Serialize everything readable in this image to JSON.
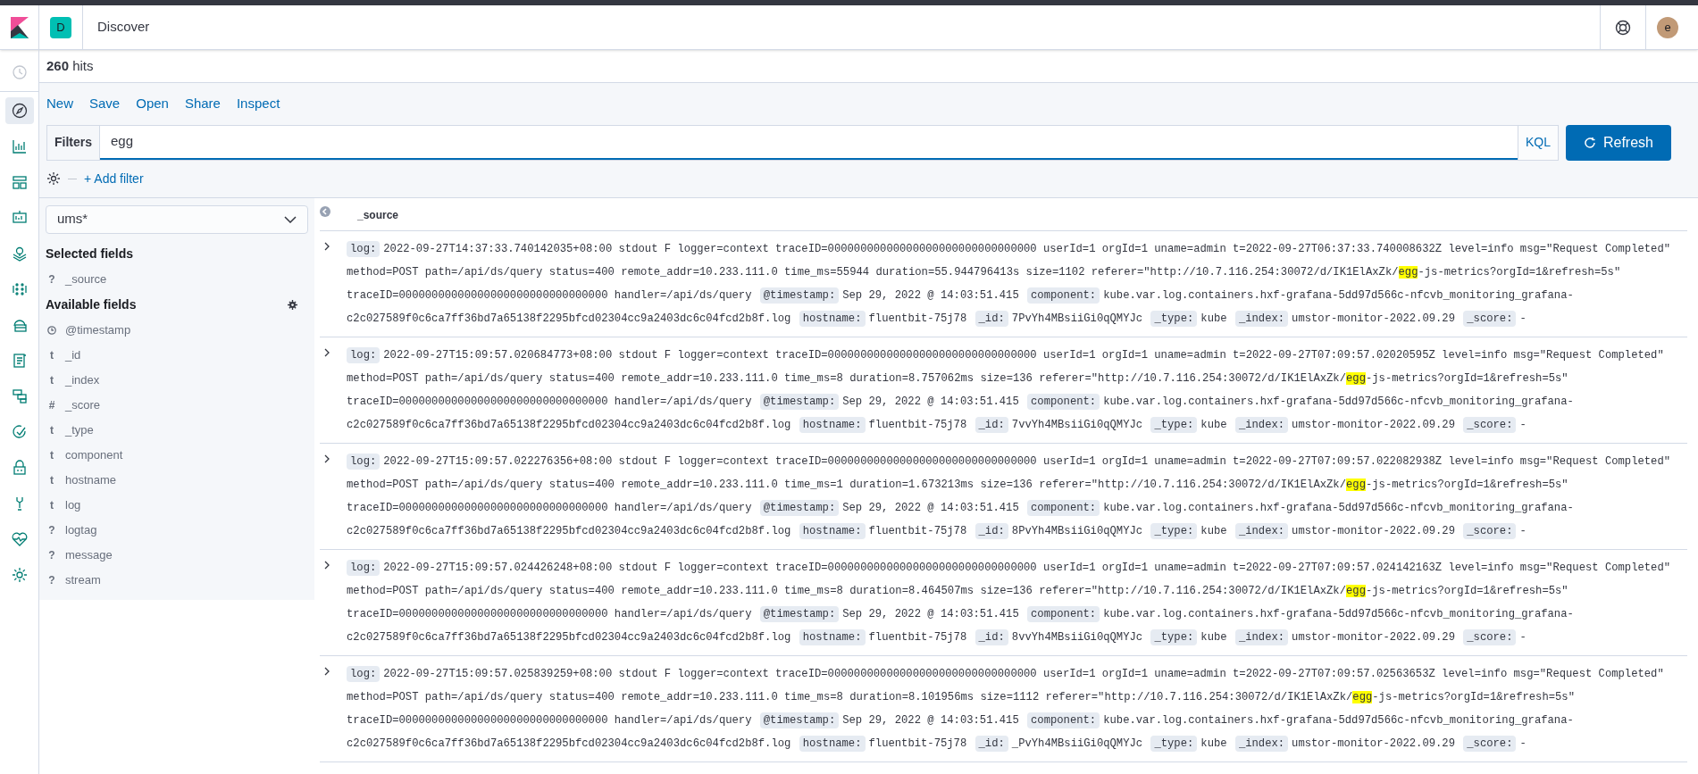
{
  "header": {
    "space_badge": "D",
    "title": "Discover",
    "avatar": "e"
  },
  "hits": {
    "count": "260",
    "label": "hits"
  },
  "top_menu": [
    "New",
    "Save",
    "Open",
    "Share",
    "Inspect"
  ],
  "query": {
    "filters_label": "Filters",
    "value": "egg",
    "language": "KQL",
    "refresh": "Refresh"
  },
  "add_filter": "+ Add filter",
  "nav_items": [
    {
      "selected": false,
      "disabled": true
    },
    {
      "selected": true,
      "disabled": false
    },
    {
      "selected": false,
      "disabled": false
    },
    {
      "selected": false,
      "disabled": false
    },
    {
      "selected": false,
      "disabled": false
    },
    {
      "selected": false,
      "disabled": false
    },
    {
      "selected": false,
      "disabled": false
    },
    {
      "selected": false,
      "disabled": false
    },
    {
      "selected": false,
      "disabled": false
    },
    {
      "selected": false,
      "disabled": false
    },
    {
      "selected": false,
      "disabled": false
    },
    {
      "selected": false,
      "disabled": false
    },
    {
      "selected": false,
      "disabled": false
    },
    {
      "selected": false,
      "disabled": false
    },
    {
      "selected": false,
      "disabled": false
    }
  ],
  "sidebar": {
    "index_pattern": "ums*",
    "selected_title": "Selected fields",
    "selected_fields": [
      {
        "kind": "glyph",
        "type": "?",
        "name": "_source"
      }
    ],
    "available_title": "Available fields",
    "available_fields": [
      {
        "kind": "clock",
        "name": "@timestamp"
      },
      {
        "kind": "glyph",
        "type": "t",
        "name": "_id"
      },
      {
        "kind": "glyph",
        "type": "t",
        "name": "_index"
      },
      {
        "kind": "glyph",
        "type": "#",
        "name": "_score"
      },
      {
        "kind": "glyph",
        "type": "t",
        "name": "_type"
      },
      {
        "kind": "glyph",
        "type": "t",
        "name": "component"
      },
      {
        "kind": "glyph",
        "type": "t",
        "name": "hostname"
      },
      {
        "kind": "glyph",
        "type": "t",
        "name": "log"
      },
      {
        "kind": "glyph",
        "type": "?",
        "name": "logtag"
      },
      {
        "kind": "glyph",
        "type": "?",
        "name": "message"
      },
      {
        "kind": "glyph",
        "type": "?",
        "name": "stream"
      }
    ]
  },
  "table": {
    "column": "_source",
    "rows": [
      {
        "fields": [
          {
            "key": "log:",
            "parts": [
              {
                "text": "2022-09-27T14:37:33.740142035+08:00 stdout F logger=context traceID=00000000000000000000000000000000 userId=1 orgId=1 uname=admin t=2022-09-27T06:37:33.740008632Z level=info msg=\"Request Completed\" method=POST path=/api/ds/query status=400 remote_addr=10.233.111.0 time_ms=55944 duration=55.944796413s size=1102 referer=\"http://10.7.116.254:30072/d/IK1ElAxZk/",
                "highlight": false
              },
              {
                "text": "egg",
                "highlight": true
              },
              {
                "text": "-js-metrics?orgId=1&refresh=5s\" traceID=00000000000000000000000000000000 handler=/api/ds/query",
                "highlight": false
              }
            ]
          },
          {
            "key": "@timestamp:",
            "parts": [
              {
                "text": "Sep 29, 2022 @ 14:03:51.415",
                "highlight": false
              }
            ]
          },
          {
            "key": "component:",
            "parts": [
              {
                "text": "kube.var.log.containers.hxf-grafana-5dd97d566c-nfcvb_monitoring_grafana-c2c027589f0c6ca7ff36bd7a65138f2295bfcd02304cc9a2403dc6c04fcd2b8f.log",
                "highlight": false
              }
            ]
          },
          {
            "key": "hostname:",
            "parts": [
              {
                "text": "fluentbit-75j78",
                "highlight": false
              }
            ]
          },
          {
            "key": "_id:",
            "parts": [
              {
                "text": "7PvYh4MBsiiGi0qQMYJc",
                "highlight": false
              }
            ]
          },
          {
            "key": "_type:",
            "parts": [
              {
                "text": "kube",
                "highlight": false
              }
            ]
          },
          {
            "key": "_index:",
            "parts": [
              {
                "text": "umstor-monitor-2022.09.29",
                "highlight": false
              }
            ]
          },
          {
            "key": "_score:",
            "parts": [
              {
                "text": "-",
                "highlight": false
              }
            ]
          }
        ]
      },
      {
        "fields": [
          {
            "key": "log:",
            "parts": [
              {
                "text": "2022-09-27T15:09:57.020684773+08:00 stdout F logger=context traceID=00000000000000000000000000000000 userId=1 orgId=1 uname=admin t=2022-09-27T07:09:57.02020595Z level=info msg=\"Request Completed\" method=POST path=/api/ds/query status=400 remote_addr=10.233.111.0 time_ms=8 duration=8.757062ms size=136 referer=\"http://10.7.116.254:30072/d/IK1ElAxZk/",
                "highlight": false
              },
              {
                "text": "egg",
                "highlight": true
              },
              {
                "text": "-js-metrics?orgId=1&refresh=5s\" traceID=00000000000000000000000000000000 handler=/api/ds/query",
                "highlight": false
              }
            ]
          },
          {
            "key": "@timestamp:",
            "parts": [
              {
                "text": "Sep 29, 2022 @ 14:03:51.415",
                "highlight": false
              }
            ]
          },
          {
            "key": "component:",
            "parts": [
              {
                "text": "kube.var.log.containers.hxf-grafana-5dd97d566c-nfcvb_monitoring_grafana-c2c027589f0c6ca7ff36bd7a65138f2295bfcd02304cc9a2403dc6c04fcd2b8f.log",
                "highlight": false
              }
            ]
          },
          {
            "key": "hostname:",
            "parts": [
              {
                "text": "fluentbit-75j78",
                "highlight": false
              }
            ]
          },
          {
            "key": "_id:",
            "parts": [
              {
                "text": "7vvYh4MBsiiGi0qQMYJc",
                "highlight": false
              }
            ]
          },
          {
            "key": "_type:",
            "parts": [
              {
                "text": "kube",
                "highlight": false
              }
            ]
          },
          {
            "key": "_index:",
            "parts": [
              {
                "text": "umstor-monitor-2022.09.29",
                "highlight": false
              }
            ]
          },
          {
            "key": "_score:",
            "parts": [
              {
                "text": "-",
                "highlight": false
              }
            ]
          }
        ]
      },
      {
        "fields": [
          {
            "key": "log:",
            "parts": [
              {
                "text": "2022-09-27T15:09:57.022276356+08:00 stdout F logger=context traceID=00000000000000000000000000000000 userId=1 orgId=1 uname=admin t=2022-09-27T07:09:57.022082938Z level=info msg=\"Request Completed\" method=POST path=/api/ds/query status=400 remote_addr=10.233.111.0 time_ms=1 duration=1.673213ms size=136 referer=\"http://10.7.116.254:30072/d/IK1ElAxZk/",
                "highlight": false
              },
              {
                "text": "egg",
                "highlight": true
              },
              {
                "text": "-js-metrics?orgId=1&refresh=5s\" traceID=00000000000000000000000000000000 handler=/api/ds/query",
                "highlight": false
              }
            ]
          },
          {
            "key": "@timestamp:",
            "parts": [
              {
                "text": "Sep 29, 2022 @ 14:03:51.415",
                "highlight": false
              }
            ]
          },
          {
            "key": "component:",
            "parts": [
              {
                "text": "kube.var.log.containers.hxf-grafana-5dd97d566c-nfcvb_monitoring_grafana-c2c027589f0c6ca7ff36bd7a65138f2295bfcd02304cc9a2403dc6c04fcd2b8f.log",
                "highlight": false
              }
            ]
          },
          {
            "key": "hostname:",
            "parts": [
              {
                "text": "fluentbit-75j78",
                "highlight": false
              }
            ]
          },
          {
            "key": "_id:",
            "parts": [
              {
                "text": "8PvYh4MBsiiGi0qQMYJc",
                "highlight": false
              }
            ]
          },
          {
            "key": "_type:",
            "parts": [
              {
                "text": "kube",
                "highlight": false
              }
            ]
          },
          {
            "key": "_index:",
            "parts": [
              {
                "text": "umstor-monitor-2022.09.29",
                "highlight": false
              }
            ]
          },
          {
            "key": "_score:",
            "parts": [
              {
                "text": "-",
                "highlight": false
              }
            ]
          }
        ]
      },
      {
        "fields": [
          {
            "key": "log:",
            "parts": [
              {
                "text": "2022-09-27T15:09:57.024426248+08:00 stdout F logger=context traceID=00000000000000000000000000000000 userId=1 orgId=1 uname=admin t=2022-09-27T07:09:57.024142163Z level=info msg=\"Request Completed\" method=POST path=/api/ds/query status=400 remote_addr=10.233.111.0 time_ms=8 duration=8.464507ms size=136 referer=\"http://10.7.116.254:30072/d/IK1ElAxZk/",
                "highlight": false
              },
              {
                "text": "egg",
                "highlight": true
              },
              {
                "text": "-js-metrics?orgId=1&refresh=5s\" traceID=00000000000000000000000000000000 handler=/api/ds/query",
                "highlight": false
              }
            ]
          },
          {
            "key": "@timestamp:",
            "parts": [
              {
                "text": "Sep 29, 2022 @ 14:03:51.415",
                "highlight": false
              }
            ]
          },
          {
            "key": "component:",
            "parts": [
              {
                "text": "kube.var.log.containers.hxf-grafana-5dd97d566c-nfcvb_monitoring_grafana-c2c027589f0c6ca7ff36bd7a65138f2295bfcd02304cc9a2403dc6c04fcd2b8f.log",
                "highlight": false
              }
            ]
          },
          {
            "key": "hostname:",
            "parts": [
              {
                "text": "fluentbit-75j78",
                "highlight": false
              }
            ]
          },
          {
            "key": "_id:",
            "parts": [
              {
                "text": "8vvYh4MBsiiGi0qQMYJc",
                "highlight": false
              }
            ]
          },
          {
            "key": "_type:",
            "parts": [
              {
                "text": "kube",
                "highlight": false
              }
            ]
          },
          {
            "key": "_index:",
            "parts": [
              {
                "text": "umstor-monitor-2022.09.29",
                "highlight": false
              }
            ]
          },
          {
            "key": "_score:",
            "parts": [
              {
                "text": "-",
                "highlight": false
              }
            ]
          }
        ]
      },
      {
        "fields": [
          {
            "key": "log:",
            "parts": [
              {
                "text": "2022-09-27T15:09:57.025839259+08:00 stdout F logger=context traceID=00000000000000000000000000000000 userId=1 orgId=1 uname=admin t=2022-09-27T07:09:57.02563653Z level=info msg=\"Request Completed\" method=POST path=/api/ds/query status=400 remote_addr=10.233.111.0 time_ms=8 duration=8.101956ms size=1112 referer=\"http://10.7.116.254:30072/d/IK1ElAxZk/",
                "highlight": false
              },
              {
                "text": "egg",
                "highlight": true
              },
              {
                "text": "-js-metrics?orgId=1&refresh=5s\" traceID=00000000000000000000000000000000 handler=/api/ds/query",
                "highlight": false
              }
            ]
          },
          {
            "key": "@timestamp:",
            "parts": [
              {
                "text": "Sep 29, 2022 @ 14:03:51.415",
                "highlight": false
              }
            ]
          },
          {
            "key": "component:",
            "parts": [
              {
                "text": "kube.var.log.containers.hxf-grafana-5dd97d566c-nfcvb_monitoring_grafana-c2c027589f0c6ca7ff36bd7a65138f2295bfcd02304cc9a2403dc6c04fcd2b8f.log",
                "highlight": false
              }
            ]
          },
          {
            "key": "hostname:",
            "parts": [
              {
                "text": "fluentbit-75j78",
                "highlight": false
              }
            ]
          },
          {
            "key": "_id:",
            "parts": [
              {
                "text": "_PvYh4MBsiiGi0qQMYJc",
                "highlight": false
              }
            ]
          },
          {
            "key": "_type:",
            "parts": [
              {
                "text": "kube",
                "highlight": false
              }
            ]
          },
          {
            "key": "_index:",
            "parts": [
              {
                "text": "umstor-monitor-2022.09.29",
                "highlight": false
              }
            ]
          },
          {
            "key": "_score:",
            "parts": [
              {
                "text": "-",
                "highlight": false
              }
            ]
          }
        ]
      }
    ]
  }
}
